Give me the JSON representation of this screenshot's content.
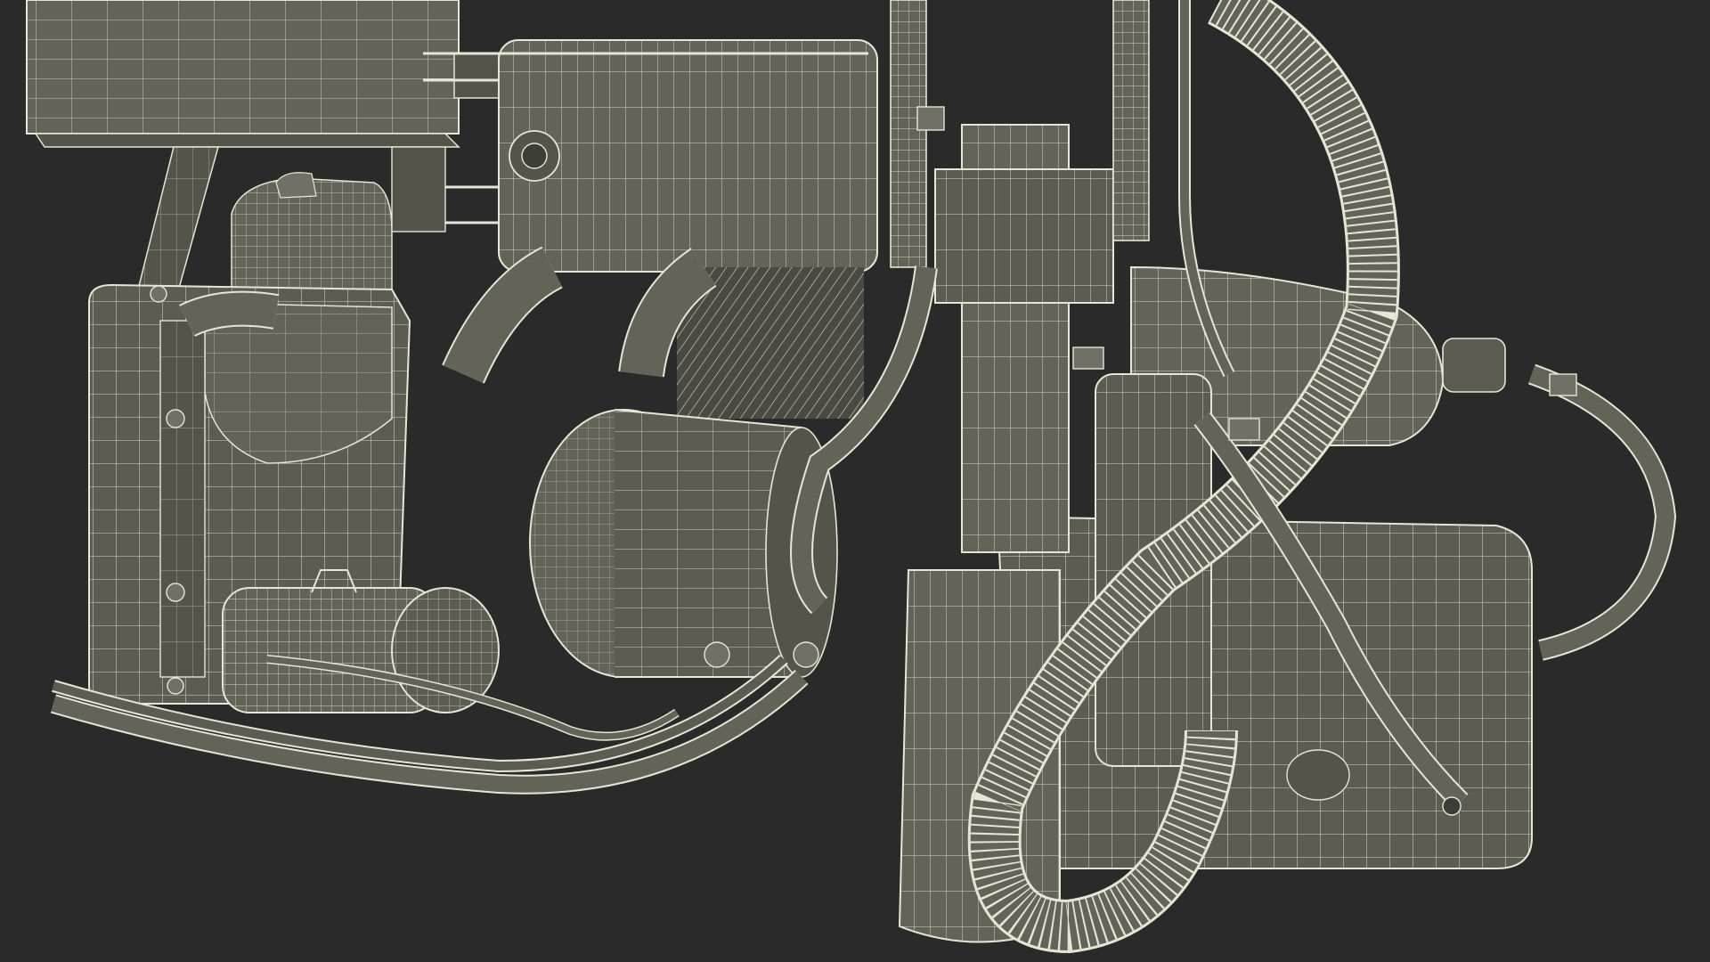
{
  "scene": {
    "subject": "wireframe-render",
    "background_color": "#2a2a2a",
    "mesh_fill_color": "#636358",
    "mesh_fill_dark": "#54544b",
    "mesh_fill_light": "#707066",
    "wire_color": "#e6e6d6",
    "wire_dim_color": "#bdbdad"
  }
}
